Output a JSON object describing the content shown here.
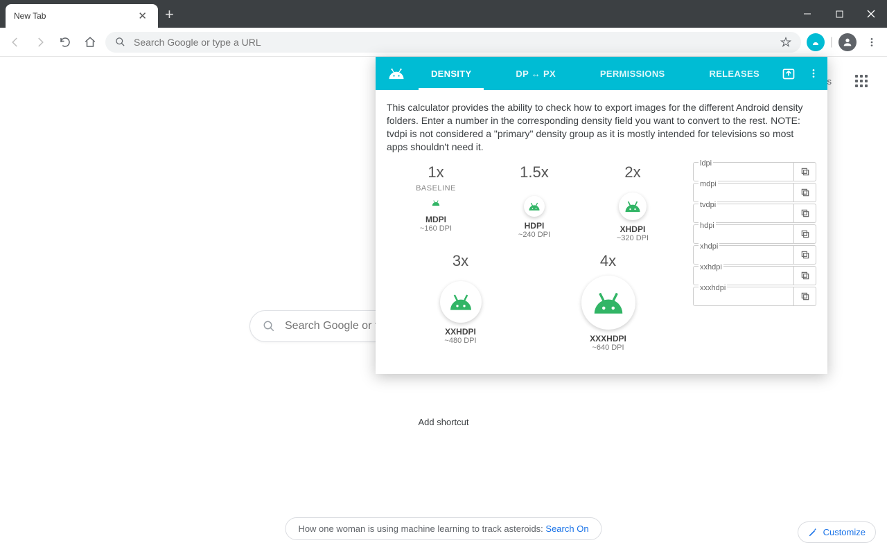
{
  "window": {
    "tab_title": "New Tab",
    "new_tab_tooltip": "New tab"
  },
  "toolbar": {
    "omnibox_placeholder": "Search Google or type a URL"
  },
  "ntp": {
    "search_placeholder": "Search Google or type a URL",
    "add_shortcut": "Add shortcut",
    "gmail_label": "ges",
    "promo_text": "How one woman is using machine learning to track asteroids: ",
    "promo_link": "Search On",
    "customize": "Customize"
  },
  "popup": {
    "tabs": {
      "density": "DENSITY",
      "dp_px": "DP ↔ PX",
      "permissions": "PERMISSIONS",
      "releases": "RELEASES"
    },
    "description": "This calculator provides the ability to check how to export images for the different Android density folders. Enter a number in the corresponding density field you want to convert to the rest. NOTE: tvdpi is not considered a \"primary\" density group as it is mostly intended for televisions so most apps shouldn't need it.",
    "densities": {
      "mdpi": {
        "mult": "1x",
        "baseline": "BASELINE",
        "name": "MDPI",
        "dpi": "~160 DPI"
      },
      "hdpi": {
        "mult": "1.5x",
        "name": "HDPI",
        "dpi": "~240 DPI"
      },
      "xhdpi": {
        "mult": "2x",
        "name": "XHDPI",
        "dpi": "~320 DPI"
      },
      "xxhdpi": {
        "mult": "3x",
        "name": "XXHDPI",
        "dpi": "~480 DPI"
      },
      "xxxhdpi": {
        "mult": "4x",
        "name": "XXXHDPI",
        "dpi": "~640 DPI"
      }
    },
    "fields": {
      "ldpi": "ldpi",
      "mdpi": "mdpi",
      "tvdpi": "tvdpi",
      "hdpi": "hdpi",
      "xhdpi": "xhdpi",
      "xxhdpi": "xxhdpi",
      "xxxhdpi": "xxxhdpi"
    }
  }
}
